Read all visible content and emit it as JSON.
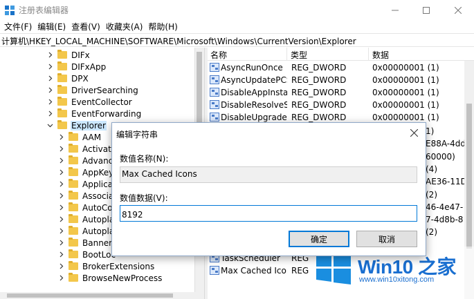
{
  "window": {
    "title": "注册表编辑器"
  },
  "menu": [
    "文件(F)",
    "编辑(E)",
    "查看(V)",
    "收藏夹(A)",
    "帮助(H)"
  ],
  "address": "计算机\\HKEY_LOCAL_MACHINE\\SOFTWARE\\Microsoft\\Windows\\CurrentVersion\\Explorer",
  "tree": {
    "items": [
      {
        "label": "DIFx",
        "expanded": false
      },
      {
        "label": "DIFxApp",
        "expanded": false
      },
      {
        "label": "DPX",
        "expanded": false
      },
      {
        "label": "DriverSearching",
        "expanded": false
      },
      {
        "label": "EventCollector",
        "expanded": false
      },
      {
        "label": "EventForwarding",
        "expanded": false
      },
      {
        "label": "Explorer",
        "expanded": true,
        "selected": true
      },
      {
        "label": "AAM",
        "expanded": false
      },
      {
        "label": "Activate",
        "expanded": false
      },
      {
        "label": "Advance",
        "expanded": false
      },
      {
        "label": "AppKey",
        "expanded": false
      },
      {
        "label": "Applicat",
        "expanded": false
      },
      {
        "label": "Associat",
        "expanded": false
      },
      {
        "label": "AutoCor",
        "expanded": false
      },
      {
        "label": "Autopla",
        "expanded": false
      },
      {
        "label": "Autopla",
        "expanded": false
      },
      {
        "label": "BannerS",
        "expanded": false
      },
      {
        "label": "BootLoc",
        "expanded": false
      },
      {
        "label": "BrokerExtensions",
        "expanded": false
      },
      {
        "label": "BrowseNewProcess",
        "expanded": false
      }
    ]
  },
  "list": {
    "columns": [
      "名称",
      "类型",
      "数据"
    ],
    "rows": [
      {
        "name": "AsyncRunOnce",
        "type": "REG_DWORD",
        "data": "0x00000001 (1)"
      },
      {
        "name": "AsyncUpdatePCSettings",
        "type": "REG_DWORD",
        "data": "0x00000001 (1)"
      },
      {
        "name": "DisableAppInstallsOnFirstLogon",
        "type": "REG_DWORD",
        "data": "0x00000001 (1)"
      },
      {
        "name": "DisableResolveStoreCategories",
        "type": "REG_DWORD",
        "data": "0x00000001 (1)"
      },
      {
        "name": "DisableUpgradeCleanup",
        "type": "REG_DWORD",
        "data": "0x00000001 (1)"
      }
    ],
    "peek_data": [
      "1)",
      "E88A-4dd",
      "60000)",
      "(4)",
      "AE36-11D",
      "(2)",
      "46-4e47-",
      "7-4d8b-8",
      "(2)"
    ],
    "bottom_rows": [
      {
        "name": "TaskScheduler",
        "type": "REG"
      },
      {
        "name": "Max Cached Icons",
        "type": "REG"
      }
    ]
  },
  "dialog": {
    "title": "编辑字符串",
    "name_label": "数值名称(N):",
    "name_value": "Max Cached Icons",
    "data_label": "数值数据(V):",
    "data_value": "8192",
    "ok": "确定",
    "cancel": "取消"
  },
  "watermark": {
    "title": "Win10 之家",
    "url": "www.win10xitong.com"
  }
}
